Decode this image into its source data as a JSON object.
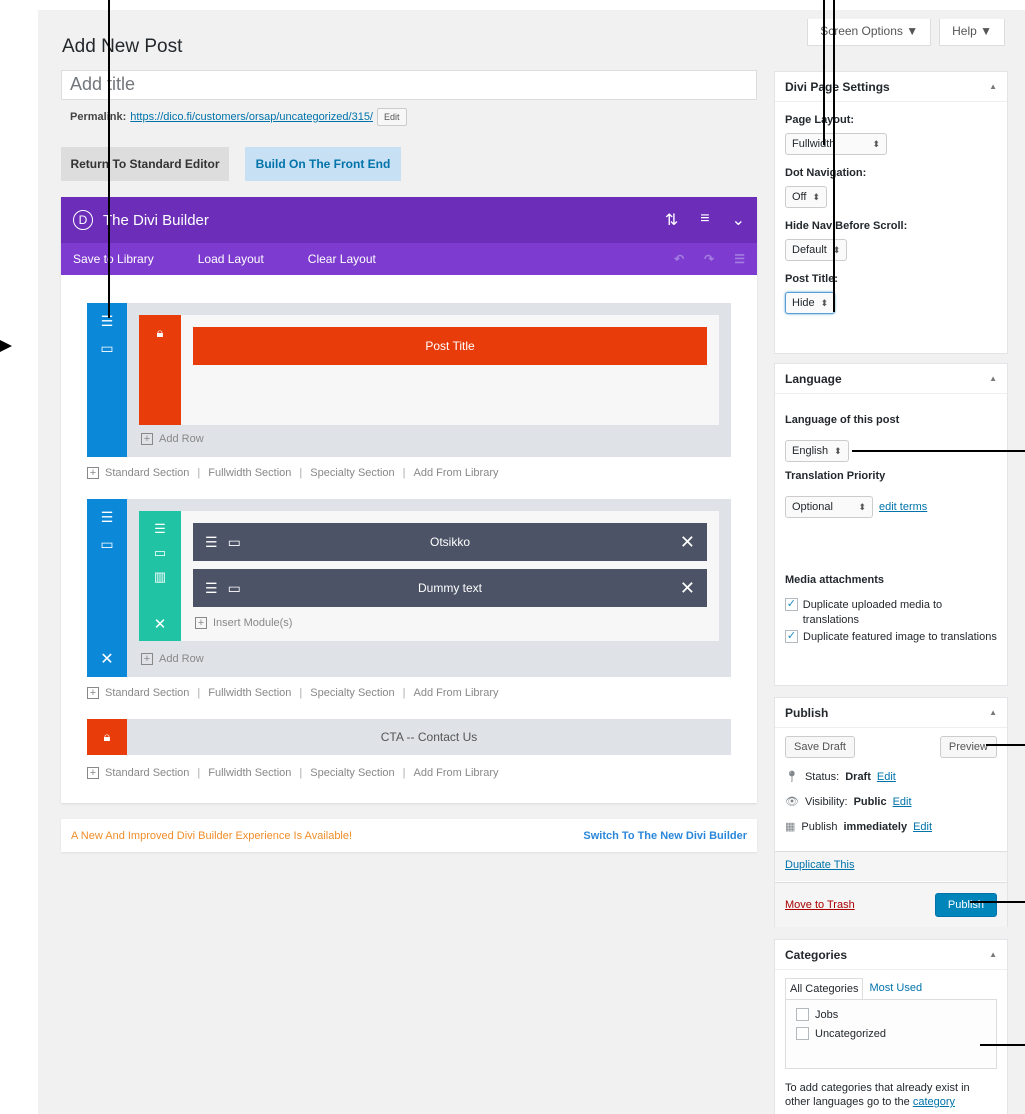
{
  "header": {
    "title": "Add New Post",
    "screen_options": "Screen Options ▼",
    "help": "Help ▼"
  },
  "post": {
    "title_placeholder": "Add title",
    "permalink_label": "Permalink:",
    "permalink_url": "https://dico.fi/customers/orsap/uncategorized/315/",
    "permalink_edit": "Edit"
  },
  "editor_buttons": {
    "standard": "Return To Standard Editor",
    "frontend": "Build On The Front End"
  },
  "builder": {
    "logo": "D",
    "title": "The Divi Builder",
    "toolbar": [
      "Save to Library",
      "Load Layout",
      "Clear Layout"
    ],
    "sections": [
      {
        "modules": [
          "Post Title"
        ],
        "add_row": "Add Row"
      },
      {
        "modules": [
          "Otsikko",
          "Dummy text"
        ],
        "insert_module": "Insert Module(s)",
        "add_row": "Add Row"
      },
      {
        "label": "CTA -- Contact Us"
      }
    ],
    "section_links": [
      "Standard Section",
      "Fullwidth Section",
      "Specialty Section",
      "Add From Library"
    ],
    "notice": "A New And Improved Divi Builder Experience Is Available!",
    "switch": "Switch To The New Divi Builder"
  },
  "divi_settings": {
    "title": "Divi Page Settings",
    "page_layout_label": "Page Layout:",
    "page_layout_value": "Fullwidth",
    "dot_nav_label": "Dot Navigation:",
    "dot_nav_value": "Off",
    "hide_nav_label": "Hide Nav Before Scroll:",
    "hide_nav_value": "Default",
    "post_title_label": "Post Title:",
    "post_title_value": "Hide"
  },
  "language": {
    "title": "Language",
    "lang_label": "Language of this post",
    "lang_value": "English",
    "priority_label": "Translation Priority",
    "priority_value": "Optional",
    "edit_terms": "edit terms",
    "media_label": "Media attachments",
    "dup_media": "Duplicate uploaded media to translations",
    "dup_featured": "Duplicate featured image to translations"
  },
  "publish": {
    "title": "Publish",
    "save_draft": "Save Draft",
    "preview": "Preview",
    "status_label": "Status:",
    "status_value": "Draft",
    "visibility_label": "Visibility:",
    "visibility_value": "Public",
    "publish_label": "Publish",
    "publish_value": "immediately",
    "edit": "Edit",
    "duplicate": "Duplicate This",
    "trash": "Move to Trash",
    "publish_btn": "Publish"
  },
  "categories": {
    "title": "Categories",
    "tab_all": "All Categories",
    "tab_used": "Most Used",
    "items": [
      "Jobs",
      "Uncategorized"
    ],
    "note": "To add categories that already exist in other languages go to the",
    "note_link": "category"
  },
  "colors": {
    "purple_header": "#6c2eb9",
    "purple_toolbar": "#7e3bd0",
    "section_blue": "#0c88d9",
    "row_red": "#e83d0b",
    "row_teal": "#21c3a5",
    "module_dark": "#4c5366",
    "wp_blue": "#0085ba"
  }
}
